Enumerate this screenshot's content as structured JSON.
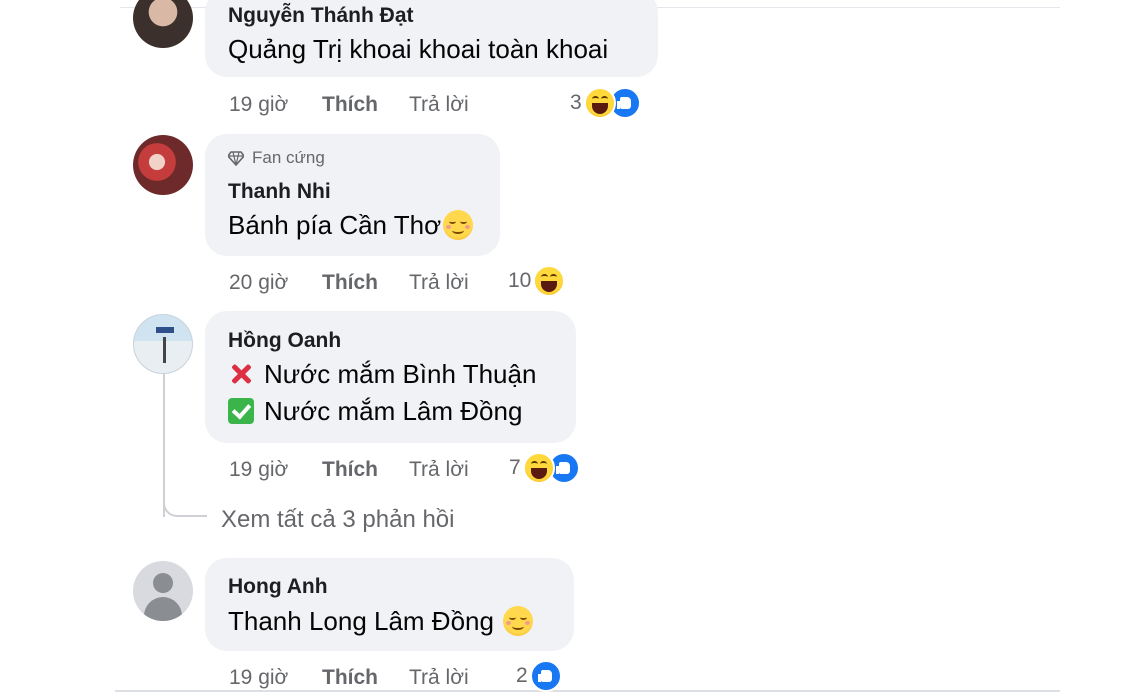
{
  "comments": [
    {
      "author": "Nguyễn Thánh Đạt",
      "text": "Quảng Trị khoai khoai toàn khoai",
      "time": "19 giờ",
      "like_label": "Thích",
      "reply_label": "Trả lời",
      "reaction_count": "3",
      "reactions": [
        "haha",
        "like"
      ]
    },
    {
      "badge": "Fan cứng",
      "author": "Thanh Nhi",
      "text": "Bánh pía Cần Thơ",
      "text_emoji": "relieved-face-emoji",
      "time": "20 giờ",
      "like_label": "Thích",
      "reply_label": "Trả lời",
      "reaction_count": "10",
      "reactions": [
        "haha"
      ]
    },
    {
      "author": "Hồng Oanh",
      "lines": [
        "Nước mắm Bình Thuận",
        "Nước mắm Lâm Đồng"
      ],
      "line_icons": [
        "cross-mark-icon",
        "check-mark-icon"
      ],
      "time": "19 giờ",
      "like_label": "Thích",
      "reply_label": "Trả lời",
      "reaction_count": "7",
      "reactions": [
        "haha",
        "like"
      ],
      "view_replies": "Xem tất cả 3 phản hồi"
    },
    {
      "author": "Hong Anh",
      "text": "Thanh Long Lâm Đồng",
      "text_emoji": "smiling-face-emoji",
      "time": "19 giờ",
      "like_label": "Thích",
      "reply_label": "Trả lời",
      "reaction_count": "2",
      "reactions": [
        "like"
      ]
    }
  ],
  "colors": {
    "bubble": "#f0f2f5",
    "meta_text": "#65676b",
    "like_blue": "#1877f2",
    "haha_yellow": "#ffd93b"
  }
}
